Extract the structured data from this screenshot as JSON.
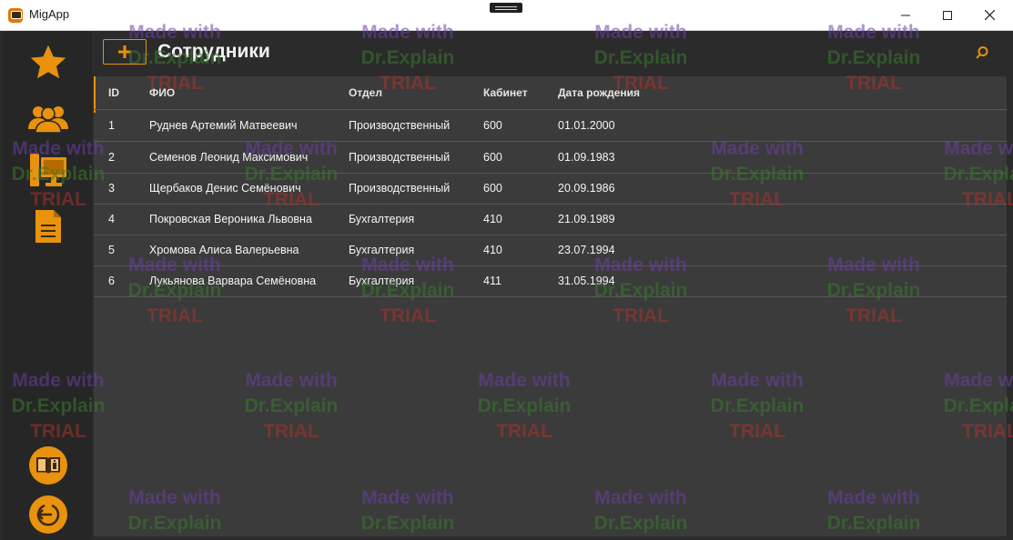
{
  "window": {
    "title": "MigApp"
  },
  "sidebar": {
    "items": [
      {
        "icon": "star-icon"
      },
      {
        "icon": "users-icon"
      },
      {
        "icon": "computer-icon"
      },
      {
        "icon": "document-icon"
      }
    ],
    "bottom": [
      {
        "icon": "book-icon"
      },
      {
        "icon": "logout-icon"
      }
    ]
  },
  "header": {
    "add_icon": "plus-icon",
    "title": "Сотрудники",
    "search_icon": "search-icon"
  },
  "table": {
    "columns": [
      "ID",
      "ФИО",
      "Отдел",
      "Кабинет",
      "Дата рождения"
    ],
    "rows": [
      [
        "1",
        "Руднев Артемий Матвеевич",
        "Производственный",
        "600",
        "01.01.2000"
      ],
      [
        "2",
        "Семенов Леонид Максимович",
        "Производственный",
        "600",
        "01.09.1983"
      ],
      [
        "3",
        "Щербаков Денис Семёнович",
        "Производственный",
        "600",
        "20.09.1986"
      ],
      [
        "4",
        "Покровская Вероника Львовна",
        "Бухгалтерия",
        "410",
        "21.09.1989"
      ],
      [
        "5",
        "Хромова Алиса Валерьевна",
        "Бухгалтерия",
        "410",
        "23.07.1994"
      ],
      [
        "6",
        "Лукьянова Варвара Семёновна",
        "Бухгалтерия",
        "411",
        "31.05.1994"
      ]
    ]
  },
  "watermark": {
    "line1": "Made with",
    "line2": "Dr.Explain",
    "line3": "TRIAL"
  },
  "colors": {
    "accent": "#e8920e",
    "background": "#2b2b2b",
    "panel": "#3b3b3b"
  }
}
